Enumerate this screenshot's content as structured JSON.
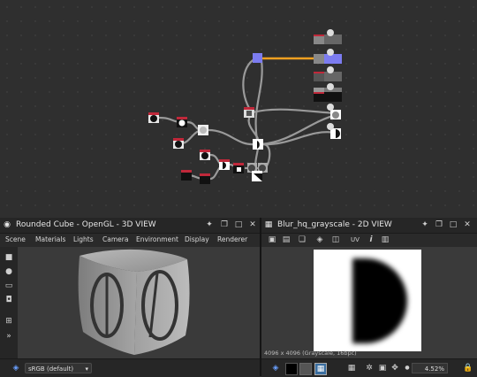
{
  "graph": {
    "colors": {
      "wire": "#9a9a9a",
      "wire_orange": "#f0a020",
      "node_blue": "#7c7cf0",
      "node_red": "#c0283a"
    }
  },
  "panel3d": {
    "title": "Rounded Cube - OpenGL - 3D VIEW",
    "menu": [
      "Scene",
      "Materials",
      "Lights",
      "Camera",
      "Environment",
      "Display",
      "Renderer"
    ],
    "colorspace": "sRGB (default)"
  },
  "panel2d": {
    "title": "Blur_hq_grayscale - 2D VIEW",
    "uv_label": "UV",
    "info_label": "4096 x 4096 (Grayscale, 16bpc)",
    "zoom": "4.52%"
  }
}
